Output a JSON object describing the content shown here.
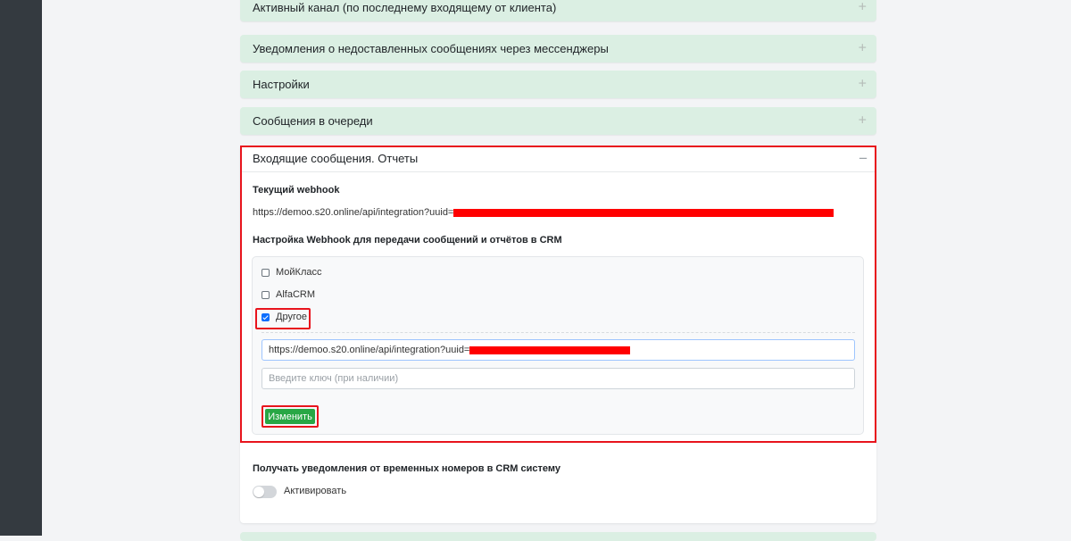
{
  "accordion": {
    "collapsed": [
      {
        "title": "Активный канал (по последнему входящему от клиента)",
        "toggle": "+"
      },
      {
        "title": "Уведомления о недоставленных сообщениях через мессенджеры",
        "toggle": "+"
      },
      {
        "title": "Настройки",
        "toggle": "+"
      },
      {
        "title": "Сообщения в очереди",
        "toggle": "+"
      }
    ],
    "open": {
      "title": "Входящие сообщения. Отчеты",
      "toggle": "−",
      "current_webhook_title": "Текущий webhook",
      "current_webhook_url": "https://demoo.s20.online/api/integration?uuid=",
      "webhook_settings_title": "Настройка Webhook для передачи сообщений и отчётов в CRM",
      "options": [
        {
          "label": "МойКласс",
          "checked": false
        },
        {
          "label": "AlfaCRM",
          "checked": false
        },
        {
          "label": "Другое",
          "checked": true
        }
      ],
      "webhook_input_value": "https://demoo.s20.online/api/integration?uuid=",
      "key_input_placeholder": "Введите ключ (при наличии)",
      "submit_label": "Изменить",
      "temp_numbers_title": "Получать уведомления от временных номеров в CRM систему",
      "activate_label": "Активировать",
      "activate_on": false
    }
  },
  "colors": {
    "accordion_header_bg": "#dbefe3",
    "highlight_red": "#e8141d",
    "button_green": "#28a745",
    "sidebar_dark": "#343a40"
  }
}
